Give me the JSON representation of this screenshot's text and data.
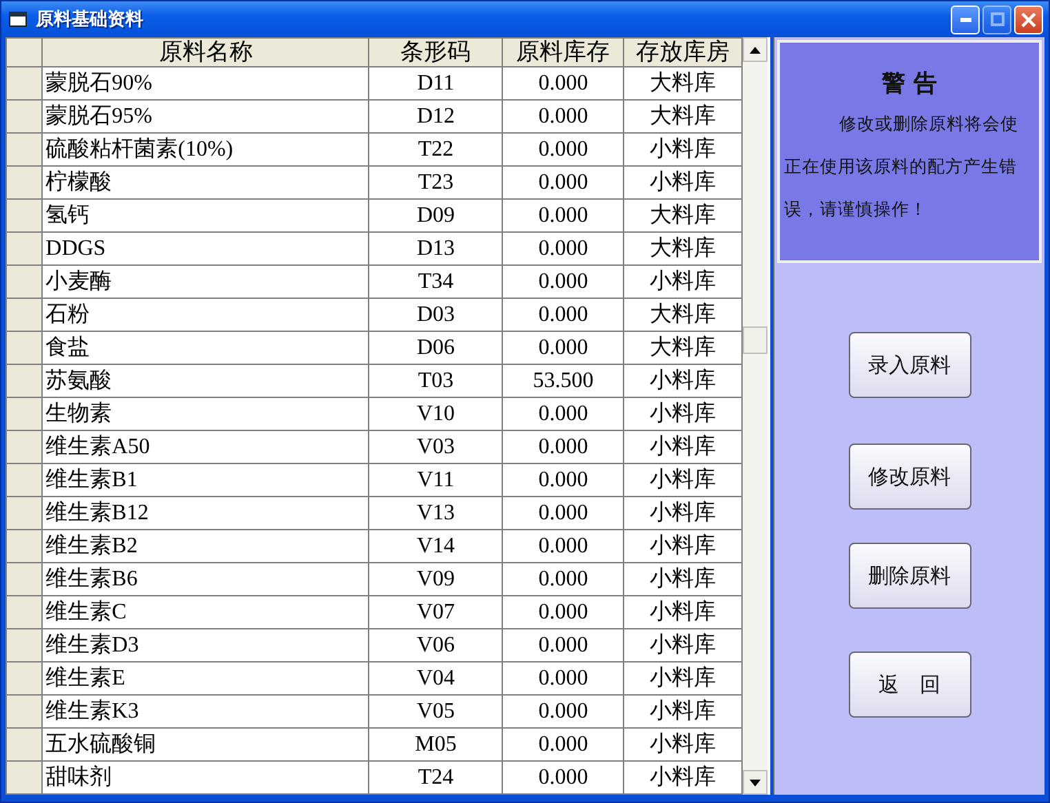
{
  "window": {
    "title": "原料基础资料"
  },
  "table": {
    "columns": [
      "原料名称",
      "条形码",
      "原料库存",
      "存放库房"
    ],
    "rows": [
      [
        "蒙脱石90%",
        "D11",
        "0.000",
        "大料库"
      ],
      [
        "蒙脱石95%",
        "D12",
        "0.000",
        "大料库"
      ],
      [
        "硫酸粘杆菌素(10%)",
        "T22",
        "0.000",
        "小料库"
      ],
      [
        "柠檬酸",
        "T23",
        "0.000",
        "小料库"
      ],
      [
        "氢钙",
        "D09",
        "0.000",
        "大料库"
      ],
      [
        "DDGS",
        "D13",
        "0.000",
        "大料库"
      ],
      [
        "小麦酶",
        "T34",
        "0.000",
        "小料库"
      ],
      [
        "石粉",
        "D03",
        "0.000",
        "大料库"
      ],
      [
        "食盐",
        "D06",
        "0.000",
        "大料库"
      ],
      [
        "苏氨酸",
        "T03",
        "53.500",
        "小料库"
      ],
      [
        "生物素",
        "V10",
        "0.000",
        "小料库"
      ],
      [
        "维生素A50",
        "V03",
        "0.000",
        "小料库"
      ],
      [
        "维生素B1",
        "V11",
        "0.000",
        "小料库"
      ],
      [
        "维生素B12",
        "V13",
        "0.000",
        "小料库"
      ],
      [
        "维生素B2",
        "V14",
        "0.000",
        "小料库"
      ],
      [
        "维生素B6",
        "V09",
        "0.000",
        "小料库"
      ],
      [
        "维生素C",
        "V07",
        "0.000",
        "小料库"
      ],
      [
        "维生素D3",
        "V06",
        "0.000",
        "小料库"
      ],
      [
        "维生素E",
        "V04",
        "0.000",
        "小料库"
      ],
      [
        "维生素K3",
        "V05",
        "0.000",
        "小料库"
      ],
      [
        "五水硫酸铜",
        "M05",
        "0.000",
        "小料库"
      ],
      [
        "甜味剂",
        "T24",
        "0.000",
        "小料库"
      ]
    ]
  },
  "warning": {
    "title": "警 告",
    "message": "修改或删除原料将会使正在使用该原料的配方产生错误，请谨慎操作！"
  },
  "buttons": [
    "录入原料",
    "修改原料",
    "删除原料",
    "返　回"
  ]
}
